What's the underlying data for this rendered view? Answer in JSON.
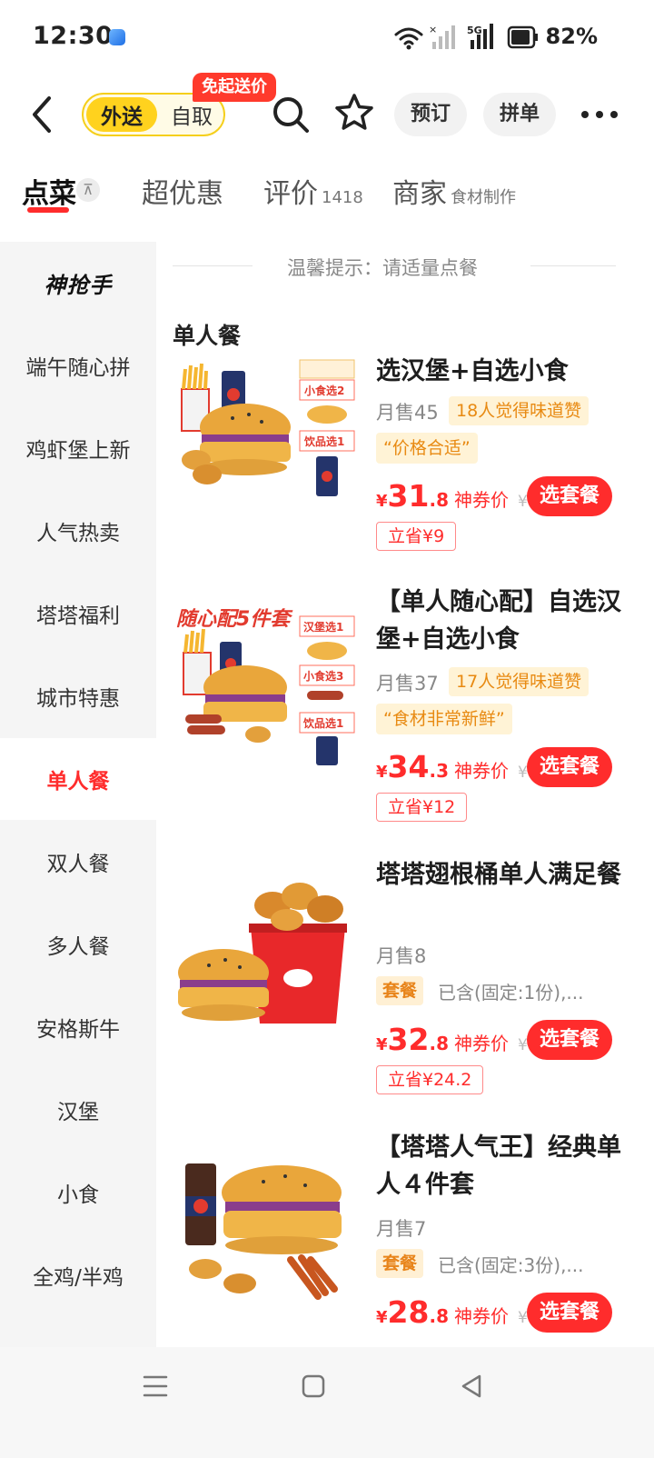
{
  "status_bar": {
    "time": "12:30",
    "battery_percent": "82%",
    "network": "5G"
  },
  "header": {
    "mode_delivery": "外送",
    "mode_pickup": "自取",
    "free_tag": "免起送价",
    "reserve_label": "预订",
    "group_label": "拼单"
  },
  "tabs": [
    {
      "label": "点菜",
      "sub": ""
    },
    {
      "label": "超优惠",
      "sub": ""
    },
    {
      "label": "评价",
      "sub": "1418"
    },
    {
      "label": "商家",
      "sub": "食材制作"
    }
  ],
  "sidebar": {
    "logo": "神抢手",
    "items": [
      "端午随心拼",
      "鸡虾堡上新",
      "人气热卖",
      "塔塔福利",
      "城市特惠",
      "单人餐",
      "双人餐",
      "多人餐",
      "安格斯牛",
      "汉堡",
      "小食",
      "全鸡/半鸡"
    ],
    "active_index": 5
  },
  "content": {
    "tip": "温馨提示：请适量点餐",
    "section_title": "单人餐",
    "items": [
      {
        "name": "选汉堡+自选小食",
        "sales": "月售45",
        "praise": "18人觉得味道赞",
        "quote": "“价格合适”",
        "price_currency": "¥",
        "price_int": "31",
        "price_dec": ".8",
        "price_label": "神券价",
        "price_old": "¥",
        "button": "选套餐",
        "save": "立省¥9",
        "image_labels": [
          "小食选2",
          "饮品选1"
        ]
      },
      {
        "name": "【单人随心配】自选汉堡+自选小食",
        "sales": "月售37",
        "praise": "17人觉得味道赞",
        "quote": "“食材非常新鲜”",
        "price_currency": "¥",
        "price_int": "34",
        "price_dec": ".3",
        "price_label": "神券价",
        "price_old": "¥",
        "button": "选套餐",
        "save": "立省¥12",
        "image_labels": [
          "随心配5件套",
          "汉堡选1",
          "小食选3",
          "饮品选1"
        ]
      },
      {
        "name": "塔塔翅根桶单人满足餐",
        "sales": "月售8",
        "set_badge": "套餐",
        "contains": "已含(固定:1份),...",
        "price_currency": "¥",
        "price_int": "32",
        "price_dec": ".8",
        "price_label": "神券价",
        "price_old": "¥",
        "button": "选套餐",
        "save": "立省¥24.2"
      },
      {
        "name": "【塔塔人气王】经典单人４件套",
        "sales": "月售7",
        "set_badge": "套餐",
        "contains": "已含(固定:3份),...",
        "price_currency": "¥",
        "price_int": "28",
        "price_dec": ".8",
        "price_label": "神券价",
        "price_old": "¥",
        "button": "选套餐"
      }
    ]
  },
  "colors": {
    "accent": "#ff2c2c",
    "yellow": "#ffd21e",
    "orange_text": "#e88a12"
  }
}
